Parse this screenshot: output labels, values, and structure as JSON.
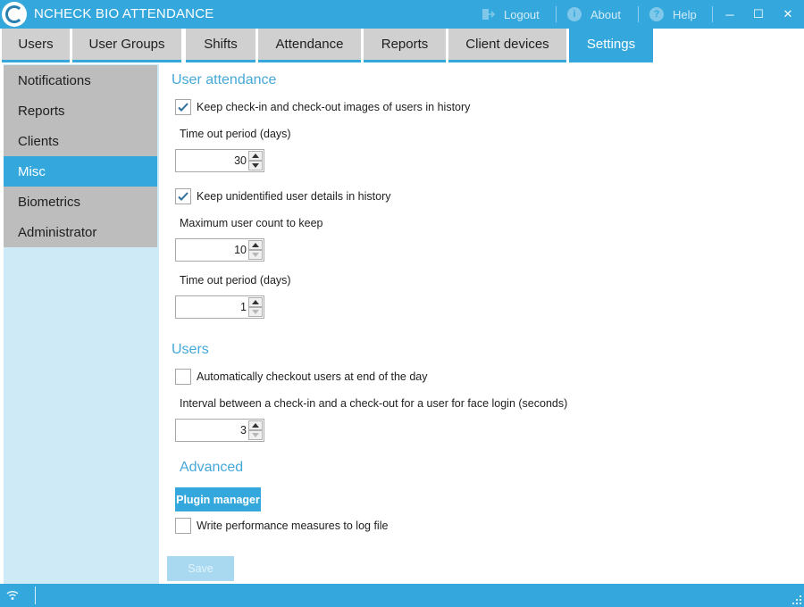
{
  "window": {
    "title": "NCHECK BIO ATTENDANCE",
    "logout_label": "Logout",
    "about_label": "About",
    "help_label": "Help",
    "about_icon_glyph": "i",
    "help_icon_glyph": "?",
    "minimize_glyph": "─",
    "maximize_glyph": "☐",
    "close_glyph": "✕"
  },
  "tabs": [
    {
      "label": "Users",
      "active": false
    },
    {
      "label": "User Groups",
      "active": false
    },
    {
      "label": "Shifts",
      "active": false
    },
    {
      "label": "Attendance",
      "active": false
    },
    {
      "label": "Reports",
      "active": false
    },
    {
      "label": "Client devices",
      "active": false
    },
    {
      "label": "Settings",
      "active": true
    }
  ],
  "sidebar": {
    "items": [
      {
        "label": "Notifications",
        "active": false
      },
      {
        "label": "Reports",
        "active": false
      },
      {
        "label": "Clients",
        "active": false
      },
      {
        "label": "Misc",
        "active": true
      },
      {
        "label": "Biometrics",
        "active": false
      },
      {
        "label": "Administrator",
        "active": false
      }
    ]
  },
  "user_attendance": {
    "heading": "User attendance",
    "keep_images": {
      "label": "Keep check-in and check-out images of users in history",
      "checked": true
    },
    "images_timeout": {
      "label": "Time out period (days)",
      "value": "30"
    },
    "keep_unidentified": {
      "label": "Keep unidentified user details in history",
      "checked": true
    },
    "max_user_count": {
      "label": "Maximum user count to keep",
      "value": "10"
    },
    "unidentified_timeout": {
      "label": "Time out period (days)",
      "value": "1"
    }
  },
  "users": {
    "heading": "Users",
    "auto_checkout": {
      "label": "Automatically checkout users at end of the day",
      "checked": false
    },
    "face_interval": {
      "label": "Interval between a check-in and a check-out for a user for face login (seconds)",
      "value": "3"
    }
  },
  "advanced": {
    "heading": "Advanced",
    "plugin_manager_label": "Plugin manager",
    "perf_log": {
      "label": "Write performance measures to log file",
      "checked": false
    }
  },
  "save_label": "Save",
  "colors": {
    "accent": "#34a7dc",
    "tab_inactive": "#d0d0d0",
    "sidebar_bg": "#cfeaf7",
    "sidebar_item": "#bdbdbd",
    "heading_blue": "#46a8d8",
    "save_disabled": "#a8d9f1"
  },
  "icons": {
    "app": "ncheck-logo-icon",
    "logout": "logout-icon",
    "about": "info-icon",
    "help": "help-icon",
    "status": "wifi-icon"
  }
}
